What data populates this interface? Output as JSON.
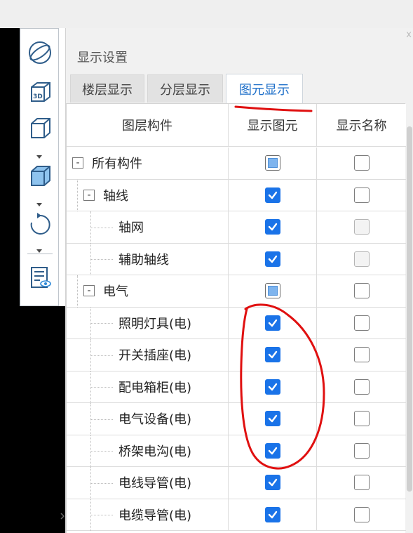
{
  "panel": {
    "title": "显示设置",
    "close_glyph": "x"
  },
  "tabs": [
    {
      "label": "楼层显示",
      "active": false
    },
    {
      "label": "分层显示",
      "active": false
    },
    {
      "label": "图元显示",
      "active": true
    }
  ],
  "table": {
    "columns": [
      "图层构件",
      "显示图元",
      "显示名称"
    ],
    "rows": [
      {
        "name": "所有构件",
        "level": 0,
        "expander": "-",
        "show_element": "partial",
        "show_name": "unchecked"
      },
      {
        "name": "轴线",
        "level": 1,
        "expander": "-",
        "show_element": "checked",
        "show_name": "unchecked"
      },
      {
        "name": "轴网",
        "level": 2,
        "expander": "",
        "show_element": "checked",
        "show_name": "disabled"
      },
      {
        "name": "辅助轴线",
        "level": 2,
        "expander": "",
        "show_element": "checked",
        "show_name": "disabled"
      },
      {
        "name": "电气",
        "level": 1,
        "expander": "-",
        "show_element": "partial",
        "show_name": "unchecked"
      },
      {
        "name": "照明灯具(电)",
        "level": 2,
        "expander": "",
        "show_element": "checked",
        "show_name": "unchecked"
      },
      {
        "name": "开关插座(电)",
        "level": 2,
        "expander": "",
        "show_element": "checked",
        "show_name": "unchecked"
      },
      {
        "name": "配电箱柜(电)",
        "level": 2,
        "expander": "",
        "show_element": "checked",
        "show_name": "unchecked"
      },
      {
        "name": "电气设备(电)",
        "level": 2,
        "expander": "",
        "show_element": "checked",
        "show_name": "unchecked"
      },
      {
        "name": "桥架电沟(电)",
        "level": 2,
        "expander": "",
        "show_element": "checked",
        "show_name": "unchecked"
      },
      {
        "name": "电线导管(电)",
        "level": 2,
        "expander": "",
        "show_element": "checked",
        "show_name": "unchecked"
      },
      {
        "name": "电缆导管(电)",
        "level": 2,
        "expander": "",
        "show_element": "checked",
        "show_name": "unchecked"
      }
    ]
  },
  "toolbar": {
    "tools": [
      "orbit-icon",
      "view-3d-icon",
      "box-wireframe-icon",
      "box-solid-icon",
      "rotate-icon",
      "layer-list-icon"
    ],
    "badge_3d": "3D"
  },
  "colors": {
    "accent": "#1a73e8",
    "active_tab_text": "#1e6fc9",
    "annotation_red": "#e01010"
  }
}
